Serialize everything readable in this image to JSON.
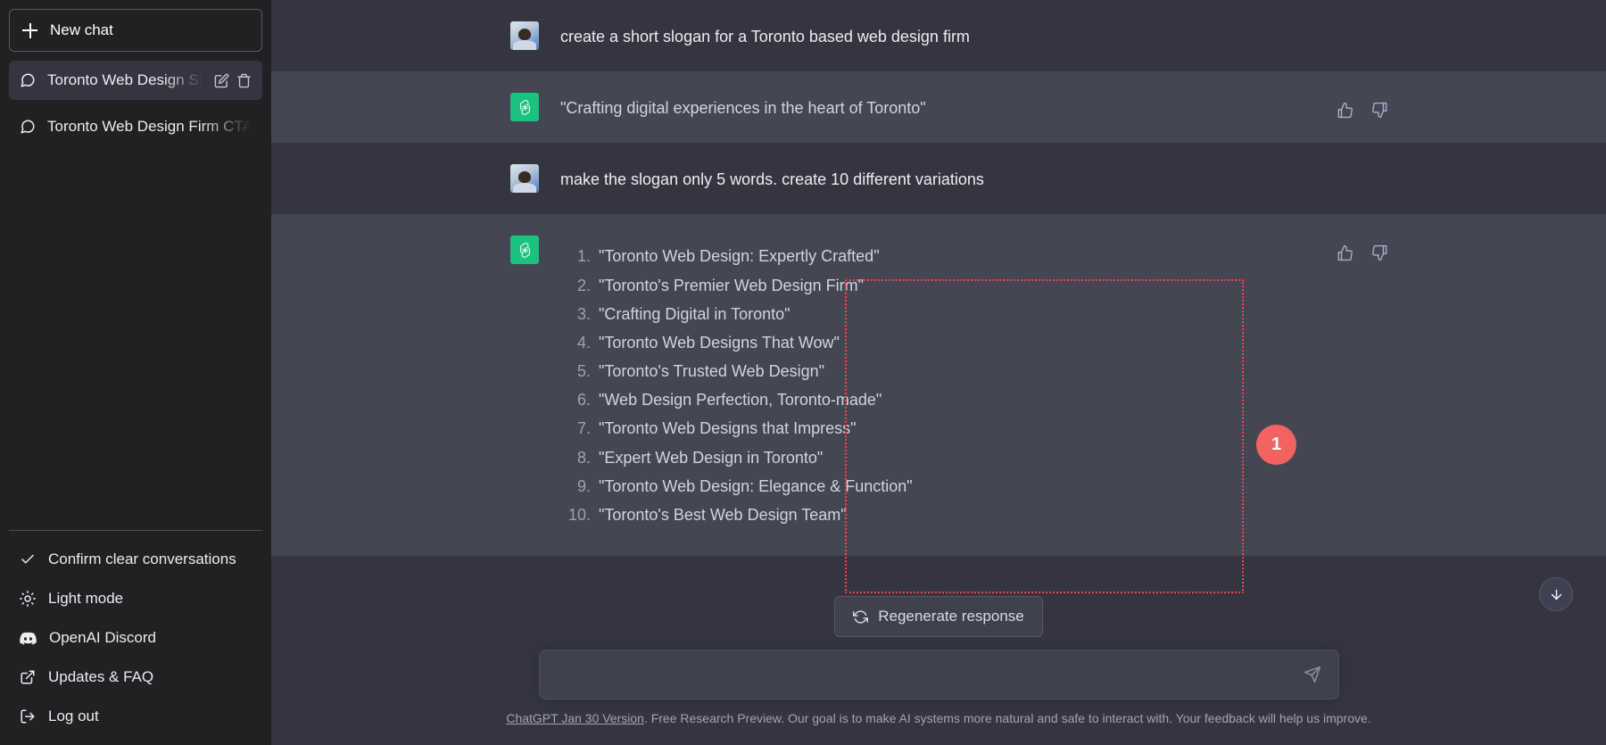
{
  "sidebar": {
    "new_chat_label": "New chat",
    "conversations": [
      {
        "title": "Toronto Web Design Sl",
        "active": true
      },
      {
        "title": "Toronto Web Design Firm CTA",
        "active": false
      }
    ],
    "menu": [
      {
        "label": "Confirm clear conversations",
        "icon": "check-icon"
      },
      {
        "label": "Light mode",
        "icon": "sun-icon"
      },
      {
        "label": "OpenAI Discord",
        "icon": "discord-icon"
      },
      {
        "label": "Updates & FAQ",
        "icon": "external-link-icon"
      },
      {
        "label": "Log out",
        "icon": "logout-icon"
      }
    ]
  },
  "thread": {
    "messages": [
      {
        "role": "user",
        "text": "create a short slogan for a Toronto based web design firm"
      },
      {
        "role": "assistant",
        "text": "\"Crafting digital experiences in the heart of Toronto\""
      },
      {
        "role": "user",
        "text": "make the slogan only 5 words. create 10 different variations"
      },
      {
        "role": "assistant",
        "list": [
          "\"Toronto Web Design: Expertly Crafted\"",
          "\"Toronto's Premier Web Design Firm\"",
          "\"Crafting Digital in Toronto\"",
          "\"Toronto Web Designs That Wow\"",
          "\"Toronto's Trusted Web Design\"",
          "\"Web Design Perfection, Toronto-made\"",
          "\"Toronto Web Designs that Impress\"",
          "\"Expert Web Design in Toronto\"",
          "\"Toronto Web Design: Elegance & Function\"",
          "\"Toronto's Best Web Design Team\""
        ]
      }
    ]
  },
  "annotation": {
    "badge_number": "1",
    "highlight_color": "#ef4444",
    "badge_color": "#f2635f"
  },
  "composer": {
    "regenerate_label": "Regenerate response",
    "input_value": "",
    "input_placeholder": ""
  },
  "footer": {
    "link_text": "ChatGPT Jan 30 Version",
    "rest_text": ". Free Research Preview. Our goal is to make AI systems more natural and safe to interact with. Your feedback will help us improve."
  },
  "colors": {
    "sidebar_bg": "#202123",
    "user_bg": "#343541",
    "assistant_bg": "#444654",
    "accent_green": "#19c37d"
  }
}
